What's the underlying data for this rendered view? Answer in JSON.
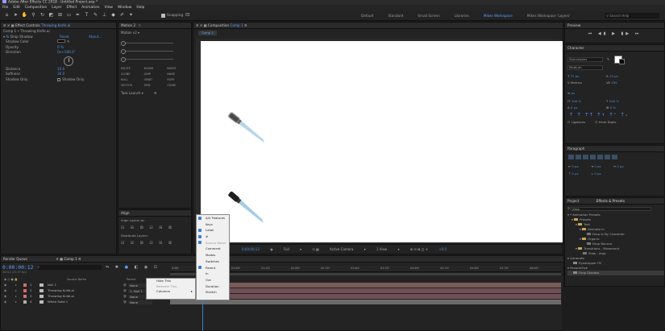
{
  "window_title": "Adobe After Effects CC 2018 - Untitled Project.aep *",
  "menu": [
    "File",
    "Edit",
    "Composition",
    "Layer",
    "Effect",
    "Animation",
    "View",
    "Window",
    "Help"
  ],
  "toolbar": {
    "snapping_label": "Snapping",
    "workspaces": [
      "Default",
      "Standard",
      "Small Screen",
      "Libraries",
      "Mikes Workspace",
      "Mikes Workspace 'Layers'"
    ],
    "active_workspace": "Mikes Workspace",
    "search_placeholder": "Search Help"
  },
  "effect_controls": {
    "tab": "Effect Controls",
    "tab_target": "Throwing Knife.ai",
    "breadcrumb": "Comp 1 • Throwing Knife.ai",
    "effect_name": "Drop Shadow",
    "reset_label": "Reset",
    "about_label": "About...",
    "props": [
      {
        "name": "Shadow Color",
        "value": ""
      },
      {
        "name": "Opacity",
        "value": "0 %"
      },
      {
        "name": "Direction",
        "value": "0x+180.0°"
      },
      {
        "name": "Distance",
        "value": "10.0"
      },
      {
        "name": "Softness",
        "value": "30.0"
      },
      {
        "name": "Shadow Only",
        "value": "Shadow Only"
      }
    ]
  },
  "motion": {
    "tab": "Motion 2",
    "preset": "Motion v2",
    "buttons": [
      "EXCITE",
      "BLEND",
      "BURST",
      "CLONE",
      "JUMP",
      "NAME",
      "NULL",
      "ORBIT",
      "ROPE",
      "VECTOR",
      "SPIN",
      "STARE"
    ],
    "task_launch": "Task Launch"
  },
  "align": {
    "tab": "Align",
    "align_label": "Align Layers to:",
    "distribute_label": "Distribute Layers:"
  },
  "composition": {
    "tab": "Composition",
    "comp_name": "Comp 1",
    "tab_chip": "Comp 1",
    "footer": {
      "timecode": "0;00;00;12",
      "resolution": "Full",
      "camera": "Active Camera",
      "views": "1 View",
      "exposure": "+0.0"
    }
  },
  "preview": {
    "tab": "Preview"
  },
  "character": {
    "tab": "Character",
    "font": "Sourcesans",
    "style": "Medium",
    "size": "72 px",
    "leading": "75 px",
    "kerning": "Metrics",
    "tracking": "200",
    "vscale": "100 %",
    "hscale": "100 %",
    "baseline": "0 px",
    "tsume": "0 %",
    "ligatures": "Ligatures",
    "hindi": "Hindi Digits"
  },
  "paragraph": {
    "tab": "Paragraph",
    "indents": [
      "0 px",
      "0 px",
      "0 px"
    ],
    "spaces": [
      "0 px",
      "0 px"
    ]
  },
  "effects_presets": {
    "tabs": [
      "Project",
      "Effects & Presets"
    ],
    "search": "drop",
    "tree": [
      {
        "depth": 0,
        "text": "* Animation Presets"
      },
      {
        "depth": 1,
        "text": "Presets"
      },
      {
        "depth": 2,
        "text": "Text"
      },
      {
        "depth": 3,
        "text": "Animate In"
      },
      {
        "depth": 4,
        "text": "Drop In By Character"
      },
      {
        "depth": 3,
        "text": "Organic"
      },
      {
        "depth": 4,
        "text": "Drop Bounce"
      },
      {
        "depth": 2,
        "text": "Transitions - Movement"
      },
      {
        "depth": 3,
        "text": "Slide - drop"
      },
      {
        "depth": 0,
        "text": "Generate"
      },
      {
        "depth": 1,
        "text": "Eyedropper Fill"
      },
      {
        "depth": 0,
        "text": "Perspective"
      },
      {
        "depth": 1,
        "text": "Drop Shadow"
      }
    ]
  },
  "timeline": {
    "tabs": [
      "Render Queue",
      "Comp 1"
    ],
    "timecode": "0:00:00:12",
    "frames": "00012 (29.97 fps)",
    "col_source": "Source Name",
    "col_parent": "Parent",
    "layers": [
      {
        "num": "1",
        "name": "Null 1",
        "parent": "None",
        "color": "#d07070"
      },
      {
        "num": "2",
        "name": "Throwing Knife.ai",
        "parent": "1. Null 1",
        "color": "#d07070"
      },
      {
        "num": "3",
        "name": "Throwing Knife.ai",
        "parent": "None",
        "color": "#d07070"
      },
      {
        "num": "4",
        "name": "White Solid 1",
        "parent": "None",
        "color": "#b0b0b0"
      }
    ],
    "ticks": [
      "0:00f",
      "00:15f",
      "01:00f",
      "01:15f",
      "02:00f",
      "02:15f",
      "03:00f",
      "03:15f",
      "04:00f",
      "04:15f",
      "05:00f",
      "05:15f",
      "06:00f"
    ]
  },
  "context_menu": [
    "Hide This",
    "Rename This...",
    "Columns"
  ],
  "columns_menu": [
    {
      "label": "A/V Features",
      "checked": true
    },
    {
      "label": "Keys",
      "checked": false
    },
    {
      "label": "Label",
      "checked": true
    },
    {
      "label": "#",
      "checked": true
    },
    {
      "label": "Source Name",
      "checked": true,
      "disabled": true
    },
    {
      "label": "Comment",
      "checked": false
    },
    {
      "label": "Modes",
      "checked": false
    },
    {
      "label": "Switches",
      "checked": false
    },
    {
      "label": "Parent",
      "checked": true
    },
    {
      "label": "In",
      "checked": false
    },
    {
      "label": "Out",
      "checked": false
    },
    {
      "label": "Duration",
      "checked": false
    },
    {
      "label": "Stretch",
      "checked": false
    }
  ]
}
